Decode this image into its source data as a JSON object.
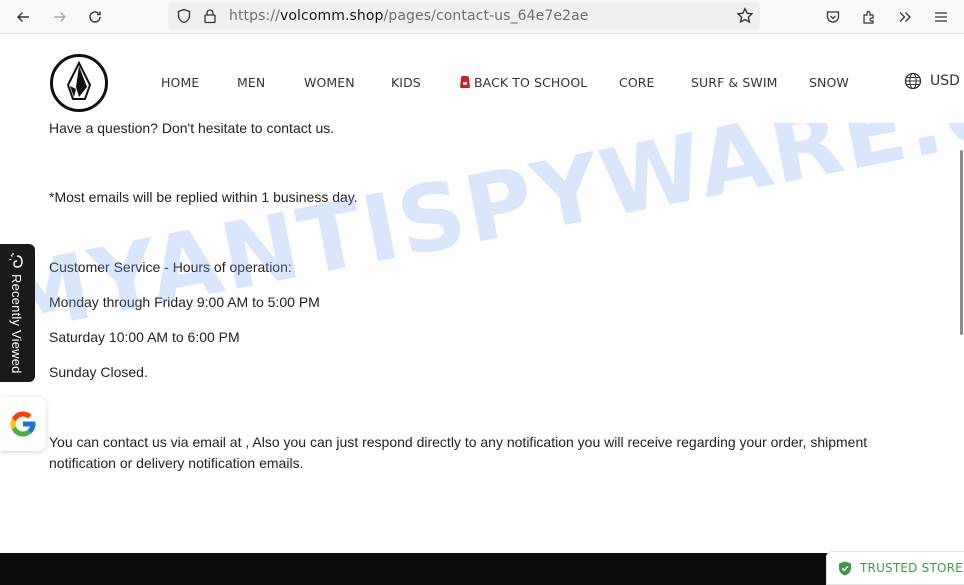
{
  "browser": {
    "url_prefix": "https://",
    "url_host": "volcomm.shop",
    "url_path": "/pages/contact-us_64e7e2ae",
    "icons": [
      "back-icon",
      "forward-icon",
      "reload-icon",
      "shield-icon",
      "lock-icon",
      "bookmark-star-icon",
      "pocket-icon",
      "extensions-icon",
      "overflow-icon",
      "menu-icon"
    ]
  },
  "header": {
    "logo_alt": "Volcom stone logo",
    "nav": [
      {
        "label": "HOME"
      },
      {
        "label": "MEN"
      },
      {
        "label": "WOMEN"
      },
      {
        "label": "KIDS"
      },
      {
        "label": "BACK TO SCHOOL",
        "icon": "backpack-icon"
      },
      {
        "label": "CORE"
      },
      {
        "label": "SURF & SWIM"
      },
      {
        "label": "SNOW"
      }
    ],
    "currency": "USD",
    "currency_icon": "globe-icon"
  },
  "content": {
    "intro": "Have a question?  Don't hesitate to contact us.",
    "reply_note": "*Most emails will be replied within 1 business day.",
    "hours_title": "Customer Service - Hours of operation:",
    "hours": [
      "Monday through Friday 9:00 AM to 5:00 PM",
      "Saturday 10:00 AM to 6:00 PM",
      "Sunday Closed."
    ],
    "contact_text": "You can contact us via email at , Also you can just respond directly to any notification you will receive regarding your order, shipment notification or delivery notification emails."
  },
  "widgets": {
    "recently_viewed": "Recently Viewed",
    "google_badge": "Google reviews",
    "trusted_store": "TRUSTED STORE"
  },
  "watermark": "MYANTISPYWARE.COM",
  "colors": {
    "trusted_green": "#3e9a4a",
    "footer_bg": "#0c0c0c",
    "backpack_red": "#c8232c"
  }
}
